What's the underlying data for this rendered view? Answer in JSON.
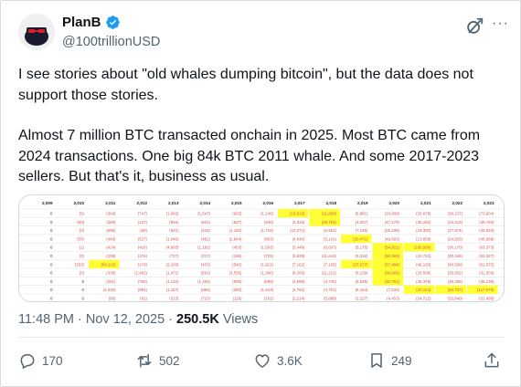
{
  "author": {
    "name": "PlanB",
    "handle": "@100trillionUSD"
  },
  "tweet": {
    "line1": "I see stories about \"old whales dumping bitcoin\", but the data does not",
    "line2": "support those stories.",
    "line3": "Almost 7 million BTC transacted onchain in 2025. Most BTC came from",
    "line4": "2024 transactions. One big 84k BTC 2011 whale. And some 2017-2023",
    "line5": "sellers. But that's it, business as usual."
  },
  "meta": {
    "time": "11:48 PM",
    "separator1": " · ",
    "date": "Nov 12, 2025",
    "separator2": " · ",
    "views_count": "250.5K",
    "views_label": " Views"
  },
  "actions": {
    "replies": "170",
    "reposts": "502",
    "likes": "3.6K",
    "bookmarks": "249"
  },
  "media": {
    "years": [
      "2,009",
      "2,010",
      "2,011",
      "2,012",
      "2,013",
      "2,014",
      "2,015",
      "2,016",
      "2,017",
      "2,018",
      "2,019",
      "2,020",
      "2,021",
      "2,022",
      "2,023",
      "2,02"
    ],
    "rows": [
      [
        "0",
        "(5)",
        "(304)",
        "(747)",
        "(1,082)",
        "(1,547)",
        "(653)",
        "(1,145)",
        "(18,013)",
        "(11,808)",
        "(6,881)",
        "(16,809)",
        "(20,678)",
        "(38,237)",
        "(73,904)",
        "(1,253,467)"
      ],
      [
        "0",
        "(50)",
        "(288)",
        "(127)",
        "(956)",
        "(501)",
        "(537)",
        "(936)",
        "(3,333)",
        "(29,784)",
        "(4,057)",
        "(47,178)",
        "(30,292)",
        "(24,219)",
        "(39,760)",
        "(444,526)"
      ],
      [
        "0",
        "(0)",
        "(696)",
        "(68)",
        "(921)",
        "(433)",
        "(1,182)",
        "(1,718)",
        "(10,271)",
        "(6,561)",
        "(7,146)",
        "(25,188)",
        "(19,300)",
        "(27,974)",
        "(30,933)",
        "(331,664)"
      ],
      [
        "0",
        "(50)",
        "(449)",
        "(527)",
        "(1,040)",
        "(482)",
        "(2,844)",
        "(803)",
        "(4,640)",
        "(5,141)",
        "(20,471)",
        "(49,893)",
        "(13,858)",
        "(24,503)",
        "(49,089)",
        "(582,615)"
      ],
      [
        "0",
        "(1)",
        "(424)",
        "(426)",
        "(4,683)",
        "(1,182)",
        "(453)",
        "(1,593)",
        "(3,449)",
        "(6,697)",
        "(5,176)",
        "(54,921)",
        "(100,586)",
        "(36,170)",
        "(63,373)",
        "(257,629)"
      ],
      [
        "0",
        "(0)",
        "(109)",
        "(276)",
        "(727)",
        "(317)",
        "(185)",
        "(729)",
        "(3,829)",
        "(11,644)",
        "(5,316)",
        "(50,369)",
        "(23,722)",
        "(30,165)",
        "(53,327)",
        "(202,175)"
      ],
      [
        "0",
        "(253)",
        "(84,110)",
        "(179)",
        "(2,103)",
        "(433)",
        "(540)",
        "(1,921)",
        "(7,162)",
        "(7,155)",
        "(27,677)",
        "(57,484)",
        "(46,130)",
        "(40,599)",
        "(61,575)",
        "(283,444)"
      ],
      [
        "0",
        "(0)",
        "(339)",
        "(2,492)",
        "(1,471)",
        "(691)",
        "(3,556)",
        "(1,380)",
        "(6,260)",
        "(11,221)",
        "(6,139)",
        "(66,666)",
        "(18,506)",
        "(29,952)",
        "(31,503)",
        "(265,426)"
      ],
      [
        "0",
        "0",
        "(261)",
        "(765)",
        "(1,134)",
        "(1,465)",
        "(506)",
        "(659)",
        "(4,699)",
        "(4,745)",
        "(6,625)",
        "(30,751)",
        "(45,379)",
        "(29,288)",
        "(36,136)",
        "(257,439)"
      ],
      [
        "0",
        "0",
        "(4,236)",
        "(884)",
        "(1,427)",
        "(866)",
        "(360)",
        "(1,643)",
        "(4,762)",
        "(4,701)",
        "(6,154)",
        "(7,533)",
        "(22,124)",
        "(63,727)",
        "(117,575)",
        "(429,570)"
      ],
      [
        "0",
        "0",
        "(90)",
        "(81)",
        "(323)",
        "(723)",
        "(116)",
        "(162)",
        "(2,214)",
        "(5,889)",
        "(2,227)",
        "(4,453)",
        "(24,712)",
        "(32,840)",
        "(31,499)",
        "(159,906)"
      ]
    ]
  },
  "colors": {
    "accent": "#1d9bf0",
    "text": "#0f1419",
    "muted": "#536471",
    "highlight": "#ffff33",
    "table_red": "#d9534f"
  }
}
